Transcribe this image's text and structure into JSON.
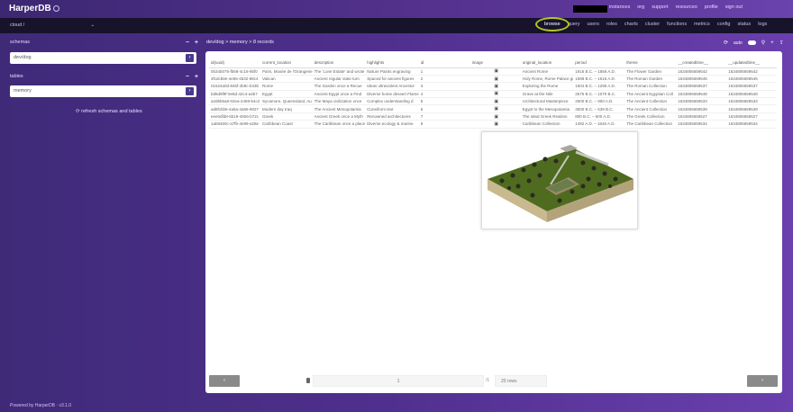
{
  "app": {
    "logo": "HarperDB"
  },
  "topnav": [
    "instances",
    "org",
    "support",
    "resources",
    "profile",
    "sign out"
  ],
  "instance": {
    "name": "cloud /"
  },
  "nav2": {
    "items": [
      "browse",
      "query",
      "users",
      "roles",
      "charts",
      "cluster",
      "functions",
      "metrics",
      "config",
      "status",
      "logs"
    ],
    "active": "browse"
  },
  "sidebar": {
    "schemas_label": "schemas",
    "schema_item": "dev/dog",
    "tables_label": "tables",
    "table_item": "memory",
    "refresh_label": "refresh schemas and tables",
    "footer": "Powered by HarperDB · v3.1.0"
  },
  "table": {
    "title": "dev/dog > memory > 8 records",
    "tools": {
      "auto": "auto"
    },
    "columns": [
      "id(uuid)",
      "current_location",
      "description",
      "highlights",
      "id",
      "image",
      "original_location",
      "period",
      "theme",
      "__createdtime__",
      "__updatedtime__"
    ],
    "rows": [
      [
        "0b34b075-fb68-4c16-9bf0",
        "Paris, Musée de l'Orangerie",
        "The 'Lone Estate' and wrote",
        "Nature Paints engraving",
        "1",
        "▣",
        "Ancient Rome",
        "1916 B.C. – 1856 A.D.",
        "The Flower Garden",
        "1634806659542",
        "1634806659542"
      ],
      [
        "3fcdcb8e-4e56-4532-88c4",
        "Vatican",
        "Ancient regular state turn",
        "Spaced for ancient figures",
        "2",
        "▣",
        "Holy Rome, Rome Palace gi",
        "1598 B.C. – 1515 A.D.",
        "The Roman Garden",
        "1634806659545",
        "1634806659545"
      ],
      [
        "01524a0d-84bf-4b9c-b43b",
        "Rome",
        "The Garden once a Recue",
        "Ideas ultraviolent Ancestor",
        "3",
        "▣",
        "Exploring the Rome",
        "1504 B.C. – 1295 A.D.",
        "The Roman Collection",
        "1634806659537",
        "1634806659537"
      ],
      [
        "bd6d9f9f-0e8d-42c4-a4b7",
        "Egypt",
        "Ancient Egypt once a Find",
        "Diverse home dessert Flame",
        "4",
        "▣",
        "Grave at the Nile",
        "2575 B.C. – 1070 B.C.",
        "The Ancient Egyptian Coll",
        "1634806659548",
        "1634806659548"
      ],
      [
        "a2d5b5a8-02ea-4469-b4c2",
        "Sycamore, Queensland, Au",
        "The Maya civilization once",
        "Complex understanding d",
        "5",
        "▣",
        "Architectural Masterpiece",
        "2600 B.C. – 900 A.D.",
        "The Ancient Collection",
        "1634806659533",
        "1634806659533"
      ],
      [
        "ad8fcbb6-4a5a-4a66-9027",
        "Modern day Iraq",
        "The Ancient Mesopotamia",
        "Cuneiform text",
        "6",
        "▣",
        "Egypt to the Mesopotamia",
        "3500 B.C. – 539 B.C.",
        "The Ancient Collection",
        "1634806659539",
        "1634806659539"
      ],
      [
        "eee0dfd8-5b19-4926-b72c",
        "Greek",
        "Ancient Greek once a Myth",
        "Renowned architectures",
        "7",
        "▣",
        "The Ideal Greek Realism",
        "800 B.C. – 600 A.D.",
        "The Greek Collection",
        "1634806659527",
        "1634806659527"
      ],
      [
        "1ab8460c-a7fb-4e99-a28e",
        "Caribbean Coast",
        "The Caribbean once a place",
        "Diverse ecology & marine",
        "8",
        "▣",
        "Caribbean Collection",
        "1492 A.D. – 1645 A.D.",
        "The Caribbean Collection",
        "1634806659534",
        "1634806659534"
      ]
    ],
    "pager": {
      "prev": "‹",
      "next": "›",
      "page": "1",
      "of": "/1",
      "page_size": "20 rows"
    }
  },
  "preview": {
    "alt": "isometric ancient garden model"
  }
}
